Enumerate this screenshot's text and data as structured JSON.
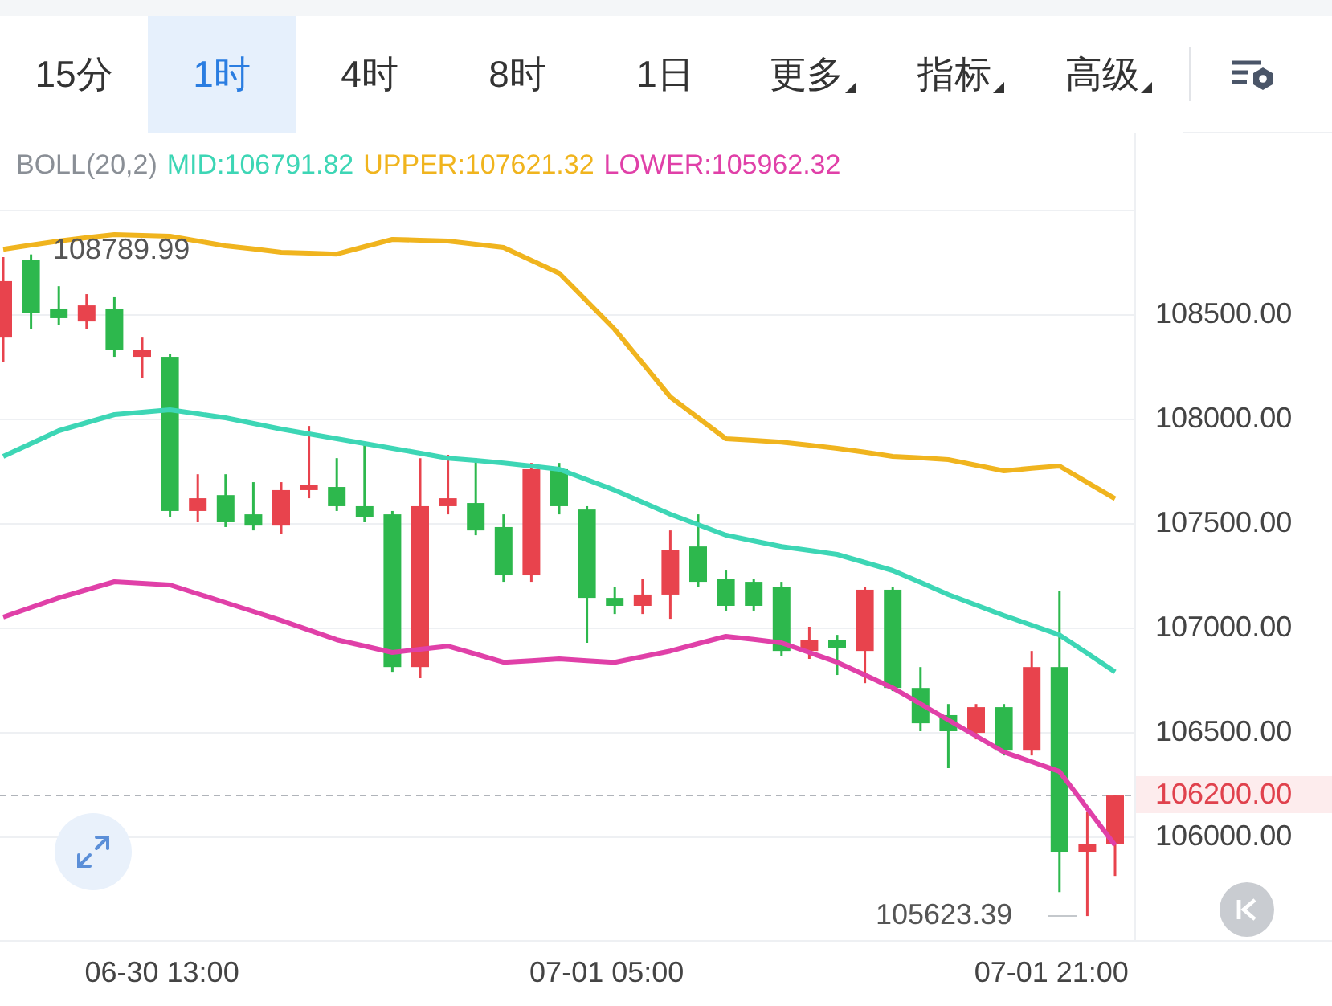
{
  "tabs": [
    {
      "label": "15分",
      "selected": false,
      "has_menu": false
    },
    {
      "label": "1时",
      "selected": true,
      "has_menu": false
    },
    {
      "label": "4时",
      "selected": false,
      "has_menu": false
    },
    {
      "label": "8时",
      "selected": false,
      "has_menu": false
    },
    {
      "label": "1日",
      "selected": false,
      "has_menu": false
    },
    {
      "label": "更多",
      "selected": false,
      "has_menu": true
    },
    {
      "label": "指标",
      "selected": false,
      "has_menu": true
    },
    {
      "label": "高级",
      "selected": false,
      "has_menu": true
    }
  ],
  "indicator": "BOLL(20,2)",
  "high_label": "108789.99",
  "low_label": "105623.39",
  "chart_data": {
    "type": "candlestick",
    "categories": [
      null,
      null,
      null,
      null,
      null,
      null,
      "06-30 13:00",
      null,
      null,
      null,
      null,
      null,
      null,
      null,
      null,
      null,
      null,
      null,
      null,
      null,
      null,
      null,
      "07-01 05:00",
      null,
      null,
      null,
      null,
      null,
      null,
      null,
      null,
      null,
      null,
      null,
      null,
      null,
      null,
      null,
      "07-01 21:00",
      null,
      null
    ],
    "ohlc": [
      [
        108392,
        108777,
        108277,
        108662
      ],
      [
        108762,
        108790,
        108431,
        108508
      ],
      [
        108531,
        108638,
        108454,
        108485
      ],
      [
        108469,
        108600,
        108431,
        108546
      ],
      [
        108531,
        108585,
        108300,
        108331
      ],
      [
        108300,
        108392,
        108200,
        108331
      ],
      [
        108300,
        108315,
        107531,
        107562
      ],
      [
        107562,
        107738,
        107508,
        107623
      ],
      [
        107638,
        107738,
        107485,
        107508
      ],
      [
        107546,
        107700,
        107469,
        107492
      ],
      [
        107492,
        107700,
        107454,
        107662
      ],
      [
        107662,
        107969,
        107623,
        107685
      ],
      [
        107677,
        107815,
        107562,
        107585
      ],
      [
        107585,
        107892,
        107508,
        107531
      ],
      [
        107546,
        107562,
        106792,
        106815
      ],
      [
        106815,
        107815,
        106762,
        107585
      ],
      [
        107585,
        107831,
        107546,
        107623
      ],
      [
        107600,
        107815,
        107446,
        107469
      ],
      [
        107485,
        107546,
        107223,
        107254
      ],
      [
        107254,
        107792,
        107223,
        107762
      ],
      [
        107762,
        107792,
        107546,
        107585
      ],
      [
        107569,
        107585,
        106931,
        107146
      ],
      [
        107146,
        107200,
        107069,
        107108
      ],
      [
        107108,
        107238,
        107069,
        107162
      ],
      [
        107162,
        107469,
        107046,
        107377
      ],
      [
        107392,
        107546,
        107200,
        107223
      ],
      [
        107238,
        107277,
        107085,
        107108
      ],
      [
        107223,
        107238,
        107085,
        107108
      ],
      [
        107200,
        107223,
        106869,
        106892
      ],
      [
        106892,
        107008,
        106854,
        106946
      ],
      [
        106946,
        106969,
        106777,
        106908
      ],
      [
        106892,
        107200,
        106738,
        107185
      ],
      [
        107185,
        107200,
        106700,
        106715
      ],
      [
        106715,
        106815,
        106508,
        106546
      ],
      [
        106585,
        106638,
        106331,
        106508
      ],
      [
        106500,
        106638,
        106469,
        106623
      ],
      [
        106623,
        106638,
        106392,
        106415
      ],
      [
        106415,
        106892,
        106392,
        106815
      ],
      [
        106815,
        107177,
        105738,
        105931
      ],
      [
        105931,
        106123,
        105623,
        105969
      ],
      [
        105969,
        106200,
        105815,
        106200
      ]
    ],
    "series": [
      {
        "name": "MID:106791.82",
        "type": "line",
        "color": "#3dd6b5",
        "values": [
          107823,
          107885,
          107946,
          107985,
          108023,
          108035,
          108046,
          108027,
          108008,
          107981,
          107954,
          107931,
          107908,
          107885,
          107862,
          107839,
          107815,
          107804,
          107792,
          107777,
          107762,
          107712,
          107662,
          107604,
          107546,
          107496,
          107446,
          107419,
          107392,
          107373,
          107354,
          107316,
          107277,
          107220,
          107162,
          107112,
          107062,
          107016,
          106969,
          106881,
          106792
        ]
      },
      {
        "name": "UPPER:107621.32",
        "type": "line",
        "color": "#f0b41e",
        "values": [
          108815,
          108835,
          108854,
          108870,
          108885,
          108881,
          108877,
          108854,
          108831,
          108816,
          108800,
          108796,
          108792,
          108827,
          108862,
          108858,
          108854,
          108839,
          108823,
          108762,
          108700,
          108566,
          108431,
          108270,
          108108,
          108008,
          107908,
          107900,
          107892,
          107877,
          107862,
          107843,
          107823,
          107816,
          107808,
          107781,
          107754,
          107766,
          107777,
          107699,
          107621
        ]
      },
      {
        "name": "LOWER:105962.32",
        "type": "line",
        "color": "#e040a8",
        "values": [
          107054,
          107100,
          107146,
          107185,
          107223,
          107216,
          107208,
          107166,
          107123,
          107081,
          107038,
          106992,
          106946,
          106916,
          106885,
          106900,
          106915,
          106877,
          106838,
          106846,
          106854,
          106846,
          106838,
          106865,
          106892,
          106927,
          106962,
          106947,
          106931,
          106885,
          106838,
          106777,
          106715,
          106639,
          106562,
          106485,
          106408,
          106362,
          106315,
          106139,
          105962
        ]
      }
    ],
    "ylim": [
      105508,
      109354
    ],
    "grid": true,
    "ref_lines": [
      {
        "axis": "y",
        "value": 106200,
        "label": "106200.00"
      }
    ],
    "yticks": [
      {
        "value": 108500,
        "label": "108500.00"
      },
      {
        "value": 108000,
        "label": "108000.00"
      },
      {
        "value": 107500,
        "label": "107500.00"
      },
      {
        "value": 107000,
        "label": "107000.00"
      },
      {
        "value": 106500,
        "label": "106500.00"
      },
      {
        "value": 106000,
        "label": "106000.00"
      }
    ]
  }
}
